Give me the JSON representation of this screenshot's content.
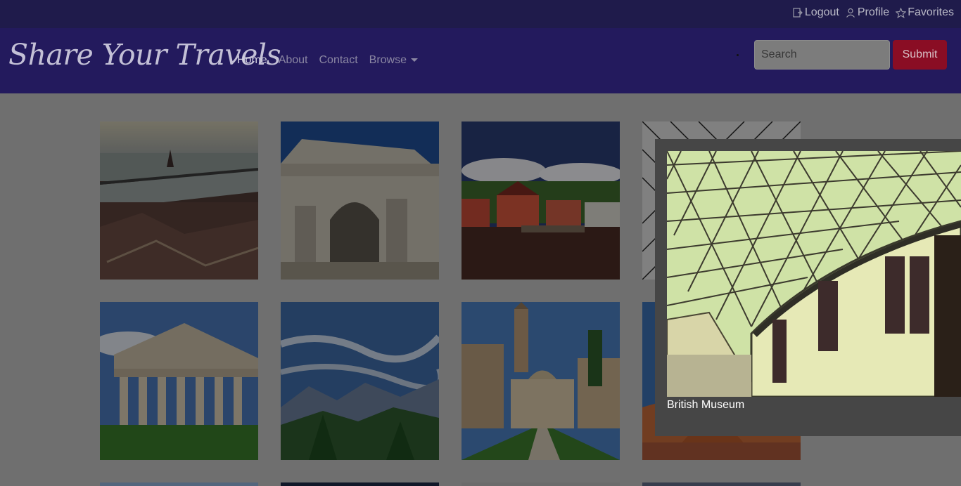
{
  "topbar": {
    "links": [
      {
        "label": "Logout",
        "icon": "logout-icon"
      },
      {
        "label": "Profile",
        "icon": "user-icon"
      },
      {
        "label": "Favorites",
        "icon": "star-icon"
      }
    ]
  },
  "navbar": {
    "brand": "Share Your Travels",
    "links": [
      "Home",
      "About",
      "Contact",
      "Browse"
    ],
    "active": "Home",
    "search_placeholder": "Search",
    "submit_label": "Submit"
  },
  "gallery": {
    "thumbnails": [
      {
        "subject": "city-with-river-and-bridge"
      },
      {
        "subject": "roman-triumphal-arch"
      },
      {
        "subject": "red-harbor-houses"
      },
      {
        "subject": "glass-lattice-roof"
      },
      {
        "subject": "greek-temple"
      },
      {
        "subject": "mountain-valley-with-pines"
      },
      {
        "subject": "church-courtyard-with-bell-tower"
      },
      {
        "subject": "cathedral-dome"
      }
    ]
  },
  "popup": {
    "caption": "British Museum",
    "image_subject": "great-court-glass-roof"
  },
  "colors": {
    "topbar_bg": "#1f1b4b",
    "navbar_bg": "#231a5d",
    "submit_bg": "#8a0d24",
    "popup_bg": "#464646",
    "page_bg": "#6f6f6f"
  }
}
